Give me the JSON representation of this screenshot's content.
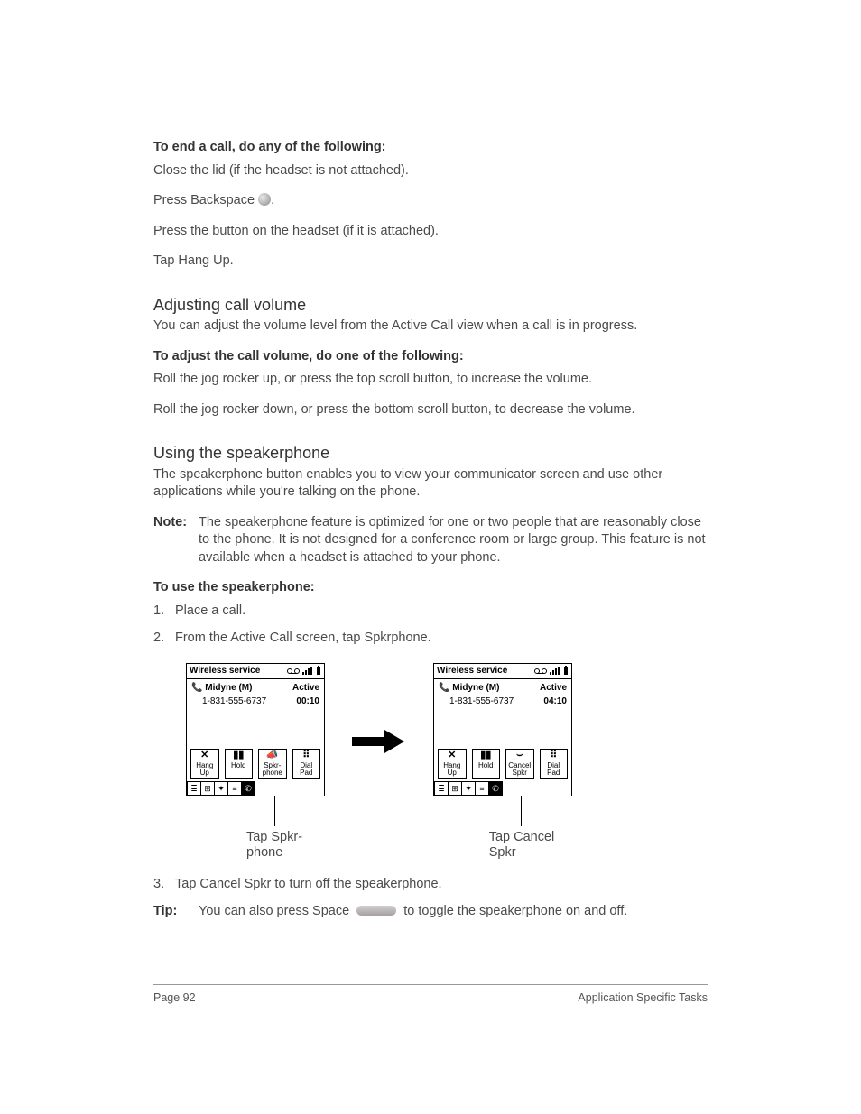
{
  "endcall": {
    "heading": "To end a call, do any of the following:",
    "items": [
      "Close the lid (if the headset is not attached).",
      "Press Backspace",
      "Press the button on the headset (if it is attached).",
      "Tap Hang Up."
    ],
    "backspace_suffix": "."
  },
  "adjust": {
    "title": "Adjusting call volume",
    "intro": "You can adjust the volume level from the Active Call view when a call is in progress.",
    "subhead": "To adjust the call volume, do one of the following:",
    "items": [
      "Roll the jog rocker up, or press the top scroll button, to increase the volume.",
      "Roll the jog rocker down, or press the bottom scroll button, to decrease the volume."
    ]
  },
  "speaker": {
    "title": "Using the speakerphone",
    "intro": "The speakerphone button enables you to view your communicator screen and use other applications while you're talking on the phone.",
    "note_label": "Note:",
    "note_text": "The speakerphone feature is optimized for one or two people that are reasonably close to the phone. It is not designed for a conference room or large group. This feature is not available when a headset is attached to your phone.",
    "subhead": "To use the speakerphone:",
    "steps": [
      "Place a call.",
      "From the Active Call screen, tap Spkrphone.",
      "Tap Cancel Spkr to turn off the speakerphone."
    ],
    "tip_label": "Tip:",
    "tip_before": "You can also press Space",
    "tip_after": " to toggle the speakerphone on and off."
  },
  "screens": {
    "service": "Wireless service",
    "contact": "Midyne (M)",
    "number": "1-831-555-6737",
    "status": "Active",
    "time_left": "00:10",
    "time_right": "04:10",
    "btn_hangup": "Hang\nUp",
    "btn_hold": "Hold",
    "btn_spkr": "Spkr-\nphone",
    "btn_cancel": "Cancel\nSpkr",
    "btn_dial": "Dial\nPad",
    "caption_left": "Tap Spkr-\nphone",
    "caption_right": "Tap Cancel\nSpkr"
  },
  "footer": {
    "left": "Page 92",
    "right": "Application Specific Tasks"
  }
}
